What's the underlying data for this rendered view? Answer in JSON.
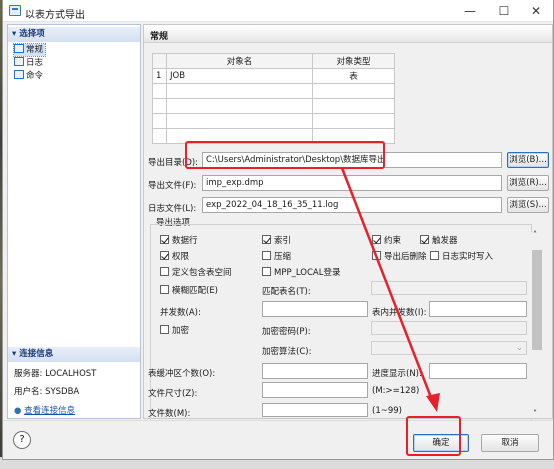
{
  "window": {
    "title": "以表方式导出",
    "minimize_glyph": "—",
    "maximize_glyph": "☐",
    "close_glyph": "✕"
  },
  "sidebar": {
    "options_header": "▾ 选择项",
    "items": [
      {
        "label": "常规"
      },
      {
        "label": "日志"
      },
      {
        "label": "命令"
      }
    ],
    "conn_header": "▾ 连接信息",
    "server_label": "服务器: LOCALHOST",
    "user_label": "用户名: SYSDBA",
    "view_conn_link": "查看连接信息"
  },
  "main": {
    "header": "常规",
    "table": {
      "headers": [
        "",
        "对象名",
        "对象类型"
      ],
      "rows": [
        [
          "1",
          "JOB",
          "表"
        ],
        [
          "",
          "",
          ""
        ],
        [
          "",
          "",
          ""
        ],
        [
          "",
          "",
          ""
        ],
        [
          "",
          "",
          ""
        ]
      ]
    },
    "export_dir_label": "导出目录(D):",
    "export_dir_value": "C:\\Users\\Administrator\\Desktop\\数据库导出",
    "export_file_label": "导出文件(F):",
    "export_file_value": "imp_exp.dmp",
    "log_file_label": "日志文件(L):",
    "log_file_value": "exp_2022_04_18_16_35_11.log",
    "browse_b": "浏览(B)...",
    "browse_r": "浏览(R)...",
    "browse_s": "浏览(S)...",
    "options_title": "导出选项"
  },
  "options": {
    "data_rows": "数据行",
    "index": "索引",
    "constraint": "约束",
    "trigger": "触发器",
    "grant": "权限",
    "compress": "压缩",
    "delete_after": "导出后删除",
    "log_realtime": "日志实时写入",
    "with_tablespace": "定义包含表空间",
    "mpp_local": "MPP_LOCAL登录",
    "fuzzy_match": "模糊匹配(E)",
    "match_table_label": "匹配表名(T):",
    "parallel_label": "并发数(A):",
    "table_parallel_label": "表内并发数(I):",
    "encrypt": "加密",
    "encrypt_pwd_label": "加密密码(P):",
    "encrypt_algo_label": "加密算法(C):",
    "table_buffer_label": "表缓冲区个数(O):",
    "progress_label": "进度显示(N):",
    "file_size_label": "文件尺寸(Z):",
    "file_size_hint": "(M:>=128)",
    "file_count_label": "文件数(M):",
    "file_count_hint": "(1~99)"
  },
  "footer": {
    "help_glyph": "?",
    "ok_label": "确定",
    "cancel_label": "取消"
  },
  "colors": {
    "highlight": "#e8202a",
    "accent": "#2f6fbd"
  }
}
